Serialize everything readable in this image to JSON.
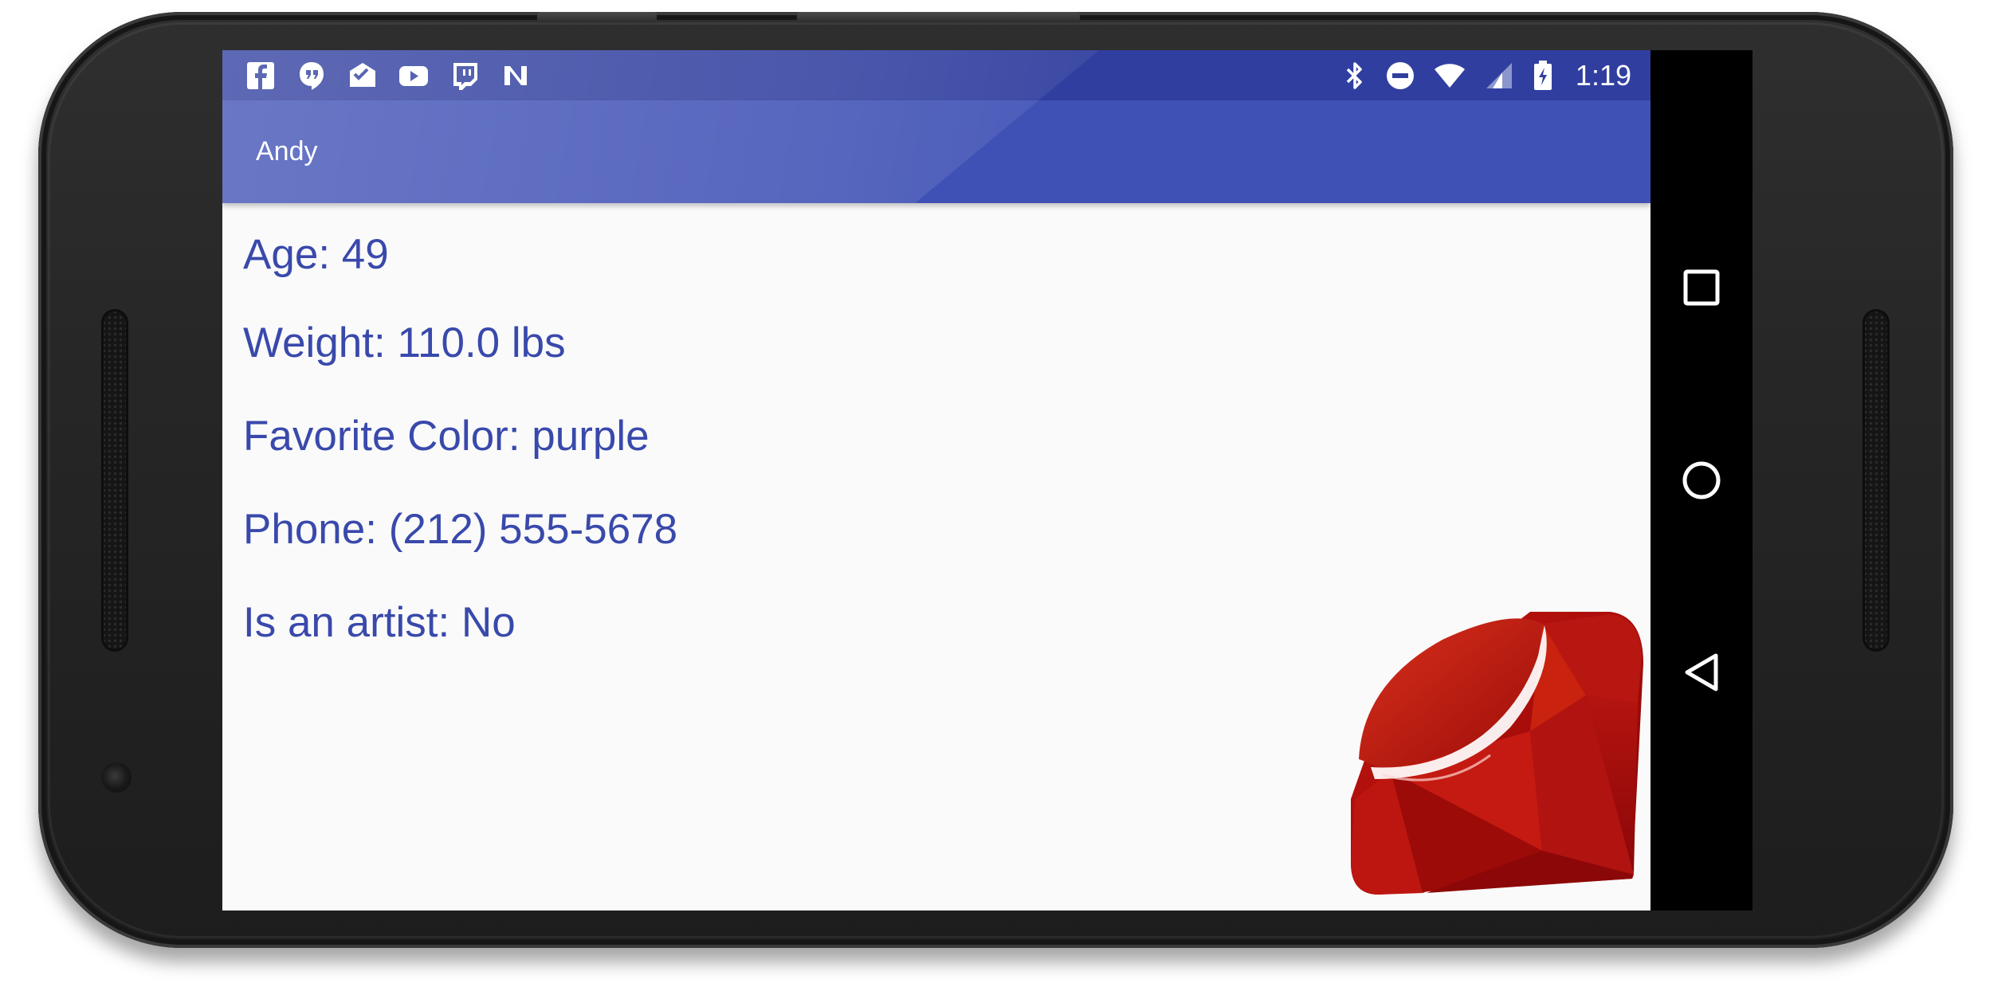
{
  "status_bar": {
    "time": "1:19",
    "color": "#303f9f",
    "notification_icons": [
      "facebook-icon",
      "hangouts-icon",
      "inbox-icon",
      "youtube-icon",
      "twitch-icon",
      "n-icon"
    ],
    "system_icons": [
      "bluetooth-icon",
      "do-not-disturb-icon",
      "wifi-icon",
      "cell-signal-icon",
      "battery-charging-icon"
    ]
  },
  "app_bar": {
    "title": "Andy",
    "color": "#3f51b5"
  },
  "profile": {
    "fields": [
      {
        "label": "Age",
        "value": "49"
      },
      {
        "label": "Weight",
        "value": "110.0 lbs"
      },
      {
        "label": "Favorite Color",
        "value": "purple"
      },
      {
        "label": "Phone",
        "value": "(212) 555-5678"
      },
      {
        "label": "Is an artist",
        "value": "No"
      }
    ],
    "text_color": "#3949ab",
    "image": "ruby-gem-image"
  },
  "nav_bar": {
    "buttons": [
      "recents-button",
      "home-button",
      "back-button"
    ]
  }
}
